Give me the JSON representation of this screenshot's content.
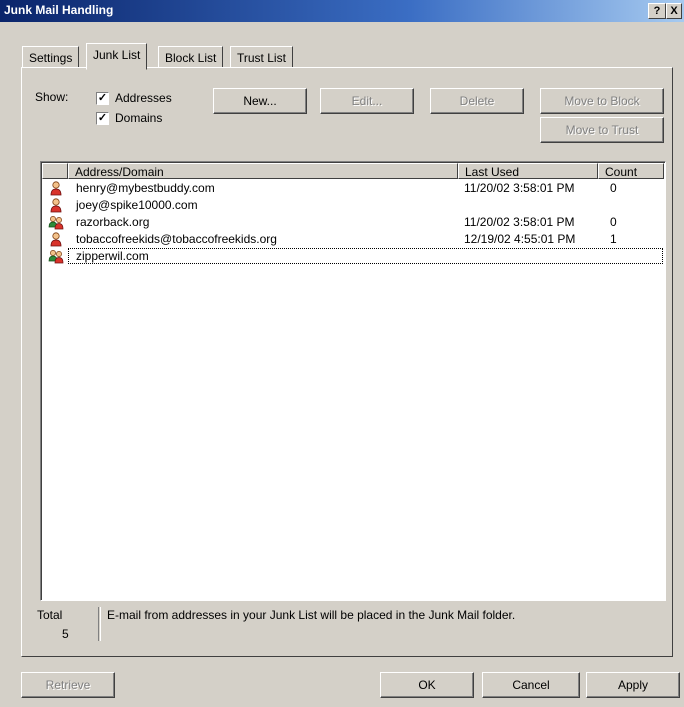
{
  "window": {
    "title": "Junk Mail Handling",
    "help_label": "?",
    "close_label": "X"
  },
  "tabs": [
    {
      "label": "Settings",
      "active": false
    },
    {
      "label": "Junk List",
      "active": true
    },
    {
      "label": "Block List",
      "active": false
    },
    {
      "label": "Trust List",
      "active": false
    }
  ],
  "show": {
    "label": "Show:",
    "addresses": {
      "label": "Addresses",
      "checked": true
    },
    "domains": {
      "label": "Domains",
      "checked": true
    }
  },
  "buttons": {
    "new": "New...",
    "edit": "Edit...",
    "delete": "Delete",
    "move_to_block": "Move to Block",
    "move_to_trust": "Move to Trust",
    "retrieve": "Retrieve",
    "ok": "OK",
    "cancel": "Cancel",
    "apply": "Apply"
  },
  "list": {
    "columns": [
      "Address/Domain",
      "Last Used",
      "Count"
    ],
    "rows": [
      {
        "icon": "single-person-icon",
        "address": "henry@mybestbuddy.com",
        "last_used": "11/20/02 3:58:01 PM",
        "count": "0"
      },
      {
        "icon": "single-person-icon",
        "address": "joey@spike10000.com",
        "last_used": "",
        "count": ""
      },
      {
        "icon": "group-icon",
        "address": "razorback.org",
        "last_used": "11/20/02 3:58:01 PM",
        "count": "0"
      },
      {
        "icon": "single-person-icon",
        "address": "tobaccofreekids@tobaccofreekids.org",
        "last_used": "12/19/02 4:55:01 PM",
        "count": "1"
      },
      {
        "icon": "group-icon",
        "address": "zipperwil.com",
        "last_used": "",
        "count": ""
      }
    ]
  },
  "status": {
    "total_label": "Total",
    "total_count": "5",
    "message": "E-mail from addresses in your Junk List will be placed in the Junk Mail folder."
  }
}
